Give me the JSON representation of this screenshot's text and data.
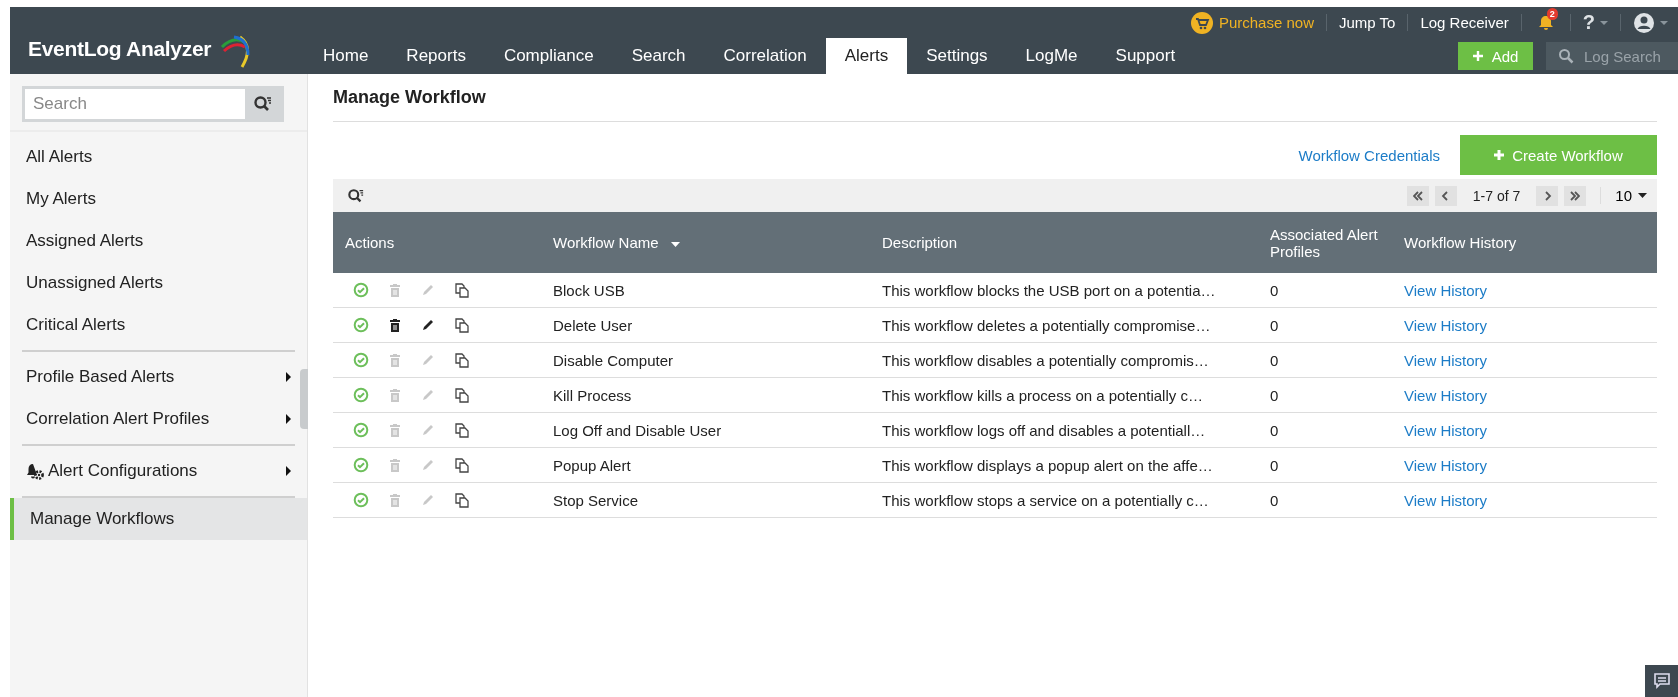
{
  "header": {
    "logo": "EventLog Analyzer",
    "top_links": [
      {
        "kind": "purchase",
        "label": "Purchase now"
      },
      {
        "kind": "link",
        "label": "Jump To"
      },
      {
        "kind": "link",
        "label": "Log Receiver"
      },
      {
        "kind": "bell",
        "badge": "2"
      },
      {
        "kind": "help",
        "label": "?"
      },
      {
        "kind": "user"
      }
    ],
    "tabs": [
      {
        "label": "Home",
        "selected": false
      },
      {
        "label": "Reports",
        "selected": false
      },
      {
        "label": "Compliance",
        "selected": false
      },
      {
        "label": "Search",
        "selected": false
      },
      {
        "label": "Correlation",
        "selected": false
      },
      {
        "label": "Alerts",
        "selected": true
      },
      {
        "label": "Settings",
        "selected": false
      },
      {
        "label": "LogMe",
        "selected": false
      },
      {
        "label": "Support",
        "selected": false
      }
    ],
    "add_button": "Add",
    "log_search": {
      "placeholder": "Log Search"
    }
  },
  "sidebar": {
    "search": {
      "placeholder": "Search"
    },
    "groups": [
      [
        {
          "label": "All Alerts",
          "selected": false,
          "submenu": false
        },
        {
          "label": "My Alerts",
          "selected": false,
          "submenu": false
        },
        {
          "label": "Assigned Alerts",
          "selected": false,
          "submenu": false
        },
        {
          "label": "Unassigned Alerts",
          "selected": false,
          "submenu": false
        },
        {
          "label": "Critical Alerts",
          "selected": false,
          "submenu": false
        }
      ],
      [
        {
          "label": "Profile Based Alerts",
          "selected": false,
          "submenu": true
        },
        {
          "label": "Correlation Alert Profiles",
          "selected": false,
          "submenu": true
        }
      ],
      [
        {
          "label": "Alert Configurations",
          "selected": false,
          "submenu": true,
          "kind": "config"
        }
      ],
      [
        {
          "label": "Manage Workflows",
          "selected": true,
          "submenu": false
        }
      ]
    ]
  },
  "page_title": "Manage Workflow",
  "credentials_link": "Workflow Credentials",
  "create_button": "Create Workflow",
  "pager": {
    "range": "1-7 of 7",
    "page_size": "10"
  },
  "table": {
    "columns": [
      "Actions",
      "Workflow Name",
      "Description",
      "Associated Alert Profiles",
      "Workflow History"
    ],
    "rows": [
      {
        "name": "Block USB",
        "description": "This workflow blocks the USB port on a potentia…",
        "profiles": "0",
        "history": "View History",
        "editable": false
      },
      {
        "name": "Delete User",
        "description": "This workflow deletes a potentially compromise…",
        "profiles": "0",
        "history": "View History",
        "editable": true
      },
      {
        "name": "Disable Computer",
        "description": "This workflow disables a potentially compromis…",
        "profiles": "0",
        "history": "View History",
        "editable": false
      },
      {
        "name": "Kill Process",
        "description": "This workflow kills a process on a potentially c…",
        "profiles": "0",
        "history": "View History",
        "editable": false
      },
      {
        "name": "Log Off and Disable User",
        "description": "This workflow logs off and disables a potentiall…",
        "profiles": "0",
        "history": "View History",
        "editable": false
      },
      {
        "name": "Popup Alert",
        "description": "This workflow displays a popup alert on the affe…",
        "profiles": "0",
        "history": "View History",
        "editable": false
      },
      {
        "name": "Stop Service",
        "description": "This workflow stops a service on a potentially c…",
        "profiles": "0",
        "history": "View History",
        "editable": false
      }
    ]
  }
}
